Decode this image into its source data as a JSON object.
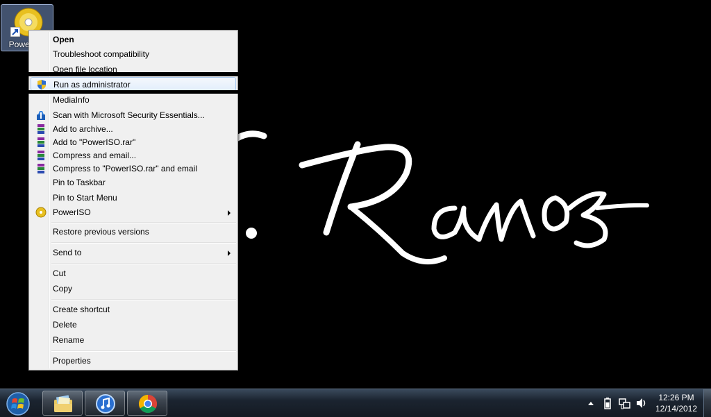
{
  "desktop": {
    "icon_label": "PowerISO",
    "wallpaper_text": "J. Ramos"
  },
  "context_menu": {
    "items": [
      {
        "label": "Open",
        "bold": true,
        "icon": ""
      },
      {
        "label": "Troubleshoot compatibility",
        "icon": ""
      },
      {
        "label": "Open file location",
        "icon": ""
      },
      {
        "label": "Run as administrator",
        "icon": "uac-shield-icon",
        "highlighted": true
      },
      {
        "label": "MediaInfo",
        "icon": ""
      },
      {
        "label": "Scan with Microsoft Security Essentials...",
        "icon": "security-essentials-icon"
      },
      {
        "label": "Add to archive...",
        "icon": "winrar-icon"
      },
      {
        "label": "Add to \"PowerISO.rar\"",
        "icon": "winrar-icon"
      },
      {
        "label": "Compress and email...",
        "icon": "winrar-icon"
      },
      {
        "label": "Compress to \"PowerISO.rar\" and email",
        "icon": "winrar-icon"
      },
      {
        "label": "Pin to Taskbar",
        "icon": ""
      },
      {
        "label": "Pin to Start Menu",
        "icon": ""
      },
      {
        "label": "PowerISO",
        "icon": "poweriso-icon",
        "submenu": true
      },
      {
        "label": "Restore previous versions",
        "icon": ""
      },
      {
        "label": "Send to",
        "icon": "",
        "submenu": true
      },
      {
        "label": "Cut",
        "icon": ""
      },
      {
        "label": "Copy",
        "icon": ""
      },
      {
        "label": "Create shortcut",
        "icon": ""
      },
      {
        "label": "Delete",
        "icon": ""
      },
      {
        "label": "Rename",
        "icon": ""
      },
      {
        "label": "Properties",
        "icon": ""
      }
    ]
  },
  "taskbar": {
    "pinned": [
      {
        "name": "windows-explorer",
        "icon": "folder-icon"
      },
      {
        "name": "itunes",
        "icon": "itunes-icon"
      },
      {
        "name": "chrome",
        "icon": "chrome-icon"
      }
    ],
    "tray_icons": [
      "show-hidden-icons-icon",
      "battery-icon",
      "network-icon",
      "volume-icon"
    ],
    "clock": {
      "time": "12:26 PM",
      "date": "12/14/2012"
    }
  },
  "colors": {
    "menu_bg": "#f0f0f0",
    "menu_highlight": "#e3eefb",
    "desktop_bg": "#000000",
    "taskbar": "#1b2430"
  }
}
